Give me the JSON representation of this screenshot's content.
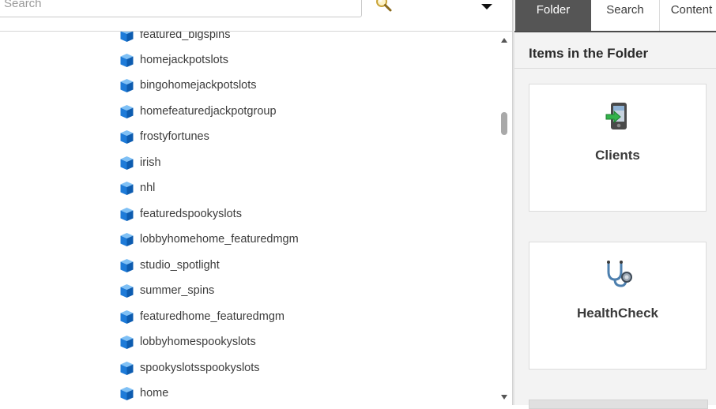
{
  "search": {
    "placeholder": "Search",
    "value": ""
  },
  "tree": {
    "items": [
      {
        "label": "featured_bigspins",
        "icon": "cube-icon"
      },
      {
        "label": "homejackpotslots",
        "icon": "cube-icon"
      },
      {
        "label": "bingohomejackpotslots",
        "icon": "cube-icon"
      },
      {
        "label": "homefeaturedjackpotgroup",
        "icon": "cube-icon"
      },
      {
        "label": "frostyfortunes",
        "icon": "cube-icon"
      },
      {
        "label": "irish",
        "icon": "cube-icon"
      },
      {
        "label": "nhl",
        "icon": "cube-icon"
      },
      {
        "label": "featuredspookyslots",
        "icon": "cube-icon"
      },
      {
        "label": "lobbyhomehome_featuredmgm",
        "icon": "cube-icon"
      },
      {
        "label": "studio_spotlight",
        "icon": "cube-icon"
      },
      {
        "label": "summer_spins",
        "icon": "cube-icon"
      },
      {
        "label": "featuredhome_featuredmgm",
        "icon": "cube-icon"
      },
      {
        "label": "lobbyhomespookyslots",
        "icon": "cube-icon"
      },
      {
        "label": "spookyslotsspookyslots",
        "icon": "cube-icon"
      },
      {
        "label": "home",
        "icon": "cube-icon"
      }
    ]
  },
  "tabs": [
    {
      "label": "Folder",
      "active": true
    },
    {
      "label": "Search",
      "active": false
    },
    {
      "label": "Content",
      "active": false
    }
  ],
  "panel": {
    "title": "Items in the Folder",
    "cards": [
      {
        "label": "Clients",
        "icon": "pda-device-icon"
      },
      {
        "label": "HealthCheck",
        "icon": "stethoscope-icon"
      }
    ]
  },
  "colors": {
    "cube": "#1e7bd8",
    "active_tab": "#555555",
    "panel_bg": "#f3f3f3"
  }
}
